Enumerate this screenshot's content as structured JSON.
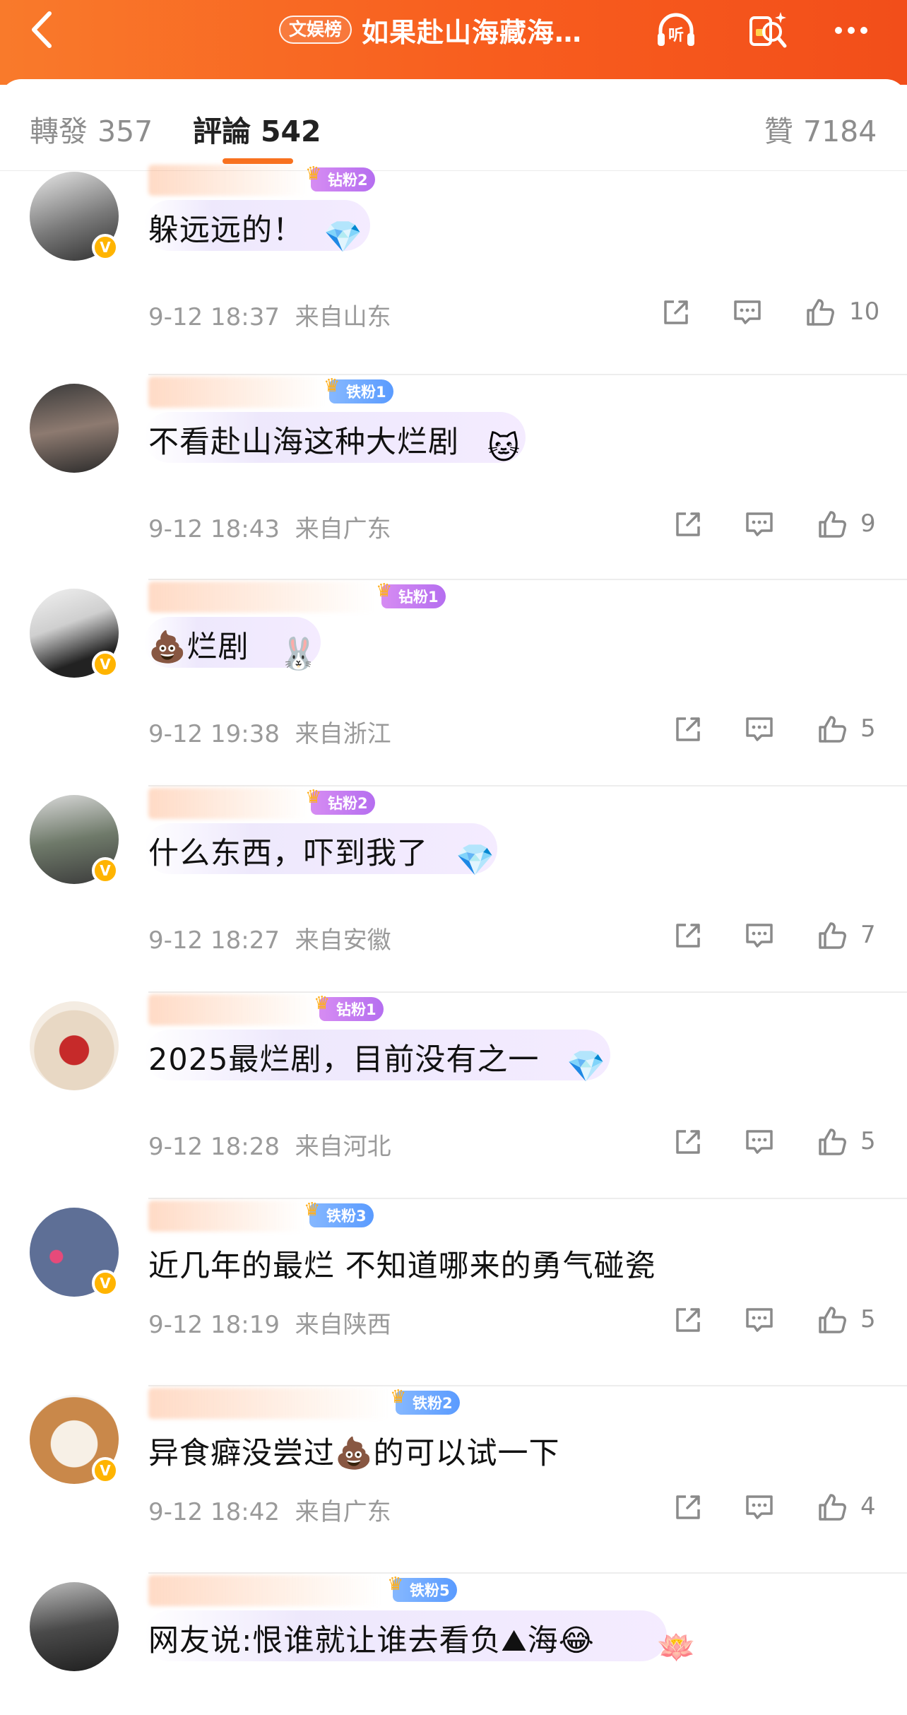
{
  "header": {
    "back_icon": "chevron-left-icon",
    "tag": "文娱榜",
    "title": "如果赴山海藏海…",
    "listen_label": "听",
    "icons": [
      "headphones-icon",
      "red-packet-search-icon",
      "more-icon"
    ]
  },
  "tabs": {
    "repost": {
      "label": "轉發",
      "count": "357"
    },
    "comments": {
      "label": "評論",
      "count": "542"
    },
    "likes": {
      "label": "贊",
      "count": "7184"
    }
  },
  "comments": [
    {
      "fan_badge": "钻粉2",
      "text": "躲远远的！",
      "sticker": "💎",
      "date": "9-12 18:37",
      "location": "来自山东",
      "likes": "10",
      "verified": true
    },
    {
      "fan_badge": "铁粉1",
      "text": "不看赴山海这种大烂剧",
      "sticker": "🐱",
      "date": "9-12 18:43",
      "location": "来自广东",
      "likes": "9",
      "verified": false
    },
    {
      "fan_badge": "钻粉1",
      "text": "💩烂剧",
      "sticker": "🐰",
      "date": "9-12 19:38",
      "location": "来自浙江",
      "likes": "5",
      "verified": true
    },
    {
      "fan_badge": "钻粉2",
      "text": "什么东西，吓到我了",
      "sticker": "💎",
      "date": "9-12 18:27",
      "location": "来自安徽",
      "likes": "7",
      "verified": true
    },
    {
      "fan_badge": "钻粉1",
      "text": "2025最烂剧，目前没有之一",
      "sticker": "💎",
      "date": "9-12 18:28",
      "location": "来自河北",
      "likes": "5",
      "verified": false
    },
    {
      "fan_badge": "铁粉3",
      "text": "近几年的最烂 不知道哪来的勇气碰瓷",
      "sticker": "",
      "date": "9-12 18:19",
      "location": "来自陕西",
      "likes": "5",
      "verified": true
    },
    {
      "fan_badge": "铁粉2",
      "text": "异食癖没尝过💩的可以试一下",
      "sticker": "",
      "date": "9-12 18:42",
      "location": "来自广东",
      "likes": "4",
      "verified": true
    },
    {
      "fan_badge": "铁粉5",
      "text": "网友说:恨谁就让谁去看负⛰海😂",
      "sticker": "🪷",
      "date": "",
      "location": "",
      "likes": "",
      "verified": false
    }
  ],
  "colors": {
    "header": "#f85d1e",
    "accent": "#f8711f",
    "diamond_badge": "#c87cf0",
    "iron_badge": "#6aa8ff",
    "verified": "#ffb400"
  }
}
